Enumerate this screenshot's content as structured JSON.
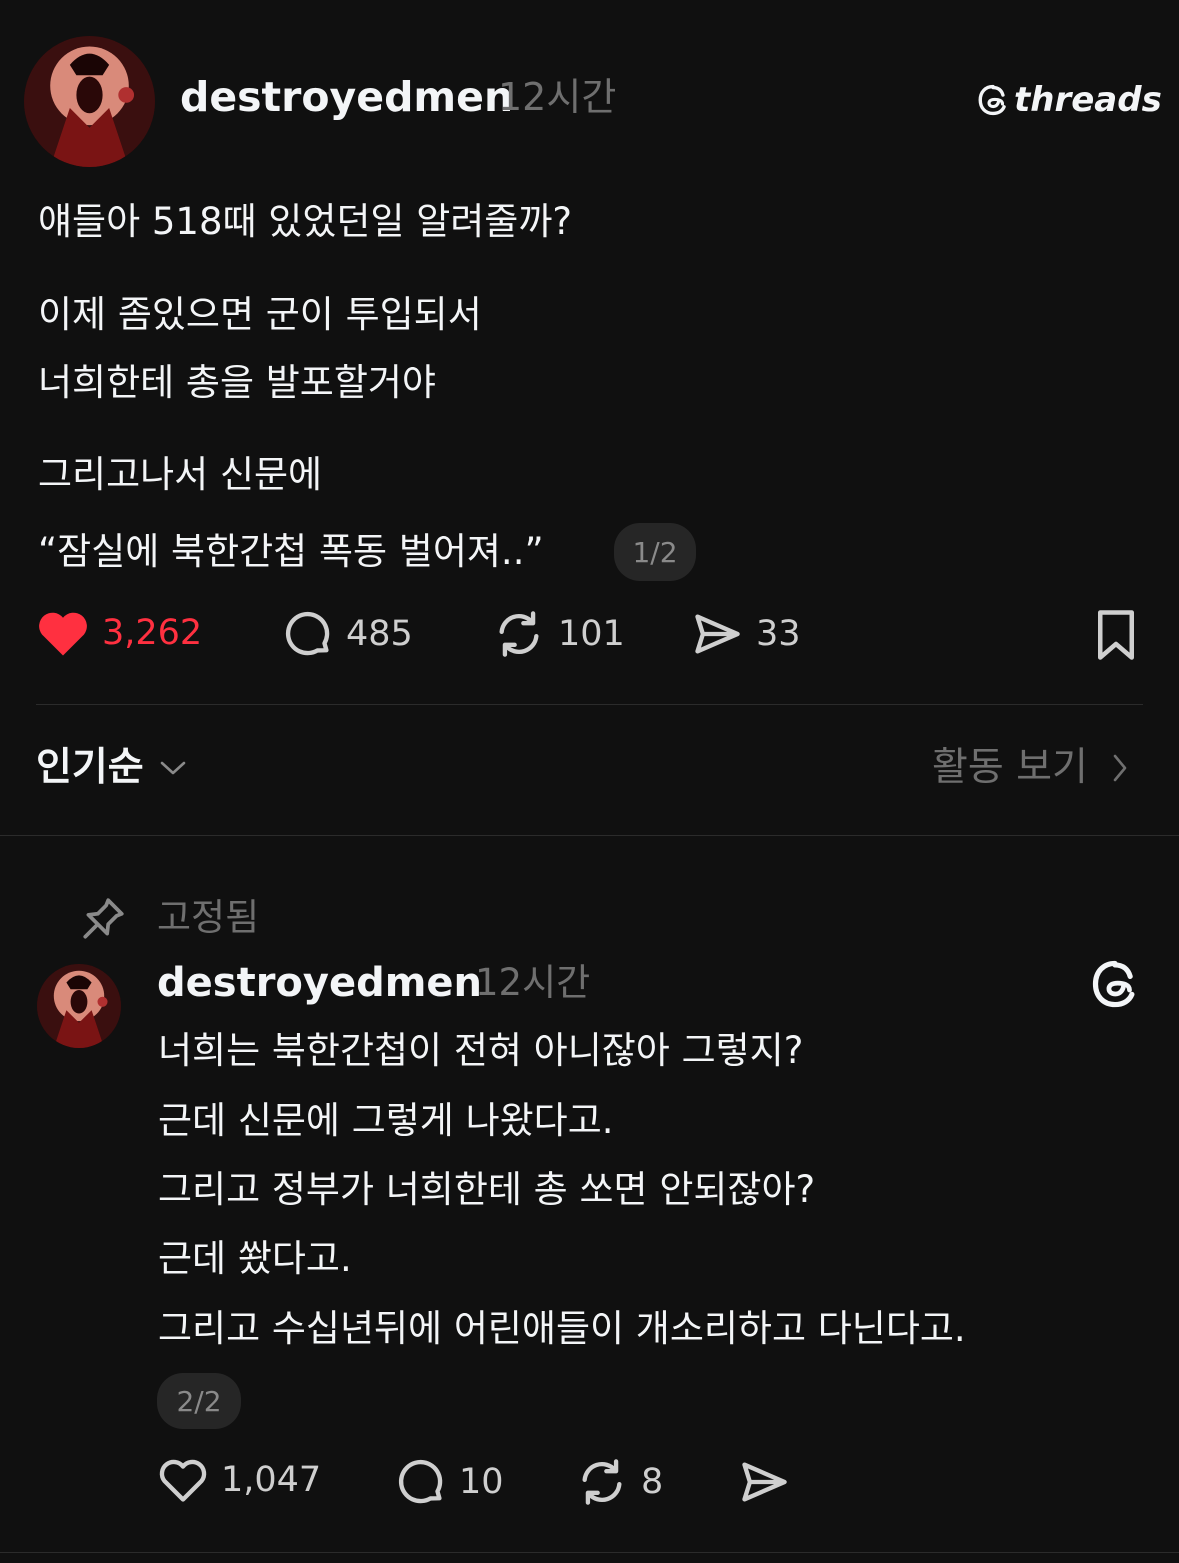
{
  "brand": {
    "logo_text": "threads"
  },
  "post": {
    "username": "destroyedmen",
    "time": "12시간",
    "lines": [
      "얘들아 518때 있었던일 알려줄까?",
      "이제 좀있으면 군이 투입되서",
      "너희한테 총을 발포할거야",
      "그리고나서 신문에",
      "“잠실에 북한간첩 폭동 벌어져..”"
    ],
    "page_indicator": "1/2",
    "likes": "3,262",
    "comments": "485",
    "reposts": "101",
    "shares": "33",
    "liked": true,
    "like_color": "#ff3040"
  },
  "sort": {
    "label": "인기순",
    "activity_label": "활동 보기"
  },
  "reply": {
    "pinned_label": "고정됨",
    "username": "destroyedmen",
    "time": "12시간",
    "lines": [
      "너희는 북한간첩이 전혀 아니잖아 그렇지?",
      "근데 신문에 그렇게 나왔다고.",
      "그리고 정부가 너희한테 총 쏘면 안되잖아?",
      "근데 쐈다고.",
      "그리고 수십년뒤에 어린애들이 개소리하고 다닌다고."
    ],
    "page_indicator": "2/2",
    "likes": "1,047",
    "comments": "10",
    "reposts": "8"
  }
}
